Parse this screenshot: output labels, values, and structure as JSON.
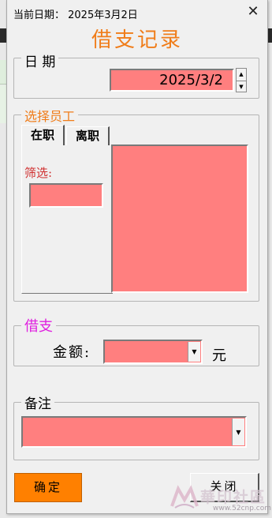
{
  "window": {
    "title_text": "当前日期：  2025年3月2日",
    "close_glyph": "✕",
    "heading": "借支记录"
  },
  "date_group": {
    "label": "日 期",
    "value": "2025/3/2",
    "spin_up": "▲",
    "spin_down": "▼"
  },
  "employee_group": {
    "label": "选择员工",
    "tabs": [
      {
        "label": "在职",
        "selected": true
      },
      {
        "label": "离职",
        "selected": false
      }
    ],
    "filter_label": "筛选:",
    "filter_value": "",
    "list_items": []
  },
  "loan_group": {
    "label": "借支",
    "amount_label": "金额:",
    "amount_value": "",
    "unit": "元",
    "dropdown_glyph": "▼"
  },
  "remark_group": {
    "label": "备注",
    "value": "",
    "dropdown_glyph": "▼"
  },
  "buttons": {
    "ok": "确定",
    "close": "关闭"
  },
  "watermark": {
    "text": "華印社區",
    "url": "www.52cnp.com"
  },
  "colors": {
    "heading": "#f07d1a",
    "input_fill": "#ff7f7f",
    "ok_button": "#ff8000",
    "loan_label": "#e020e0",
    "employee_label": "#f07d1a",
    "filter_label": "#d03030"
  }
}
